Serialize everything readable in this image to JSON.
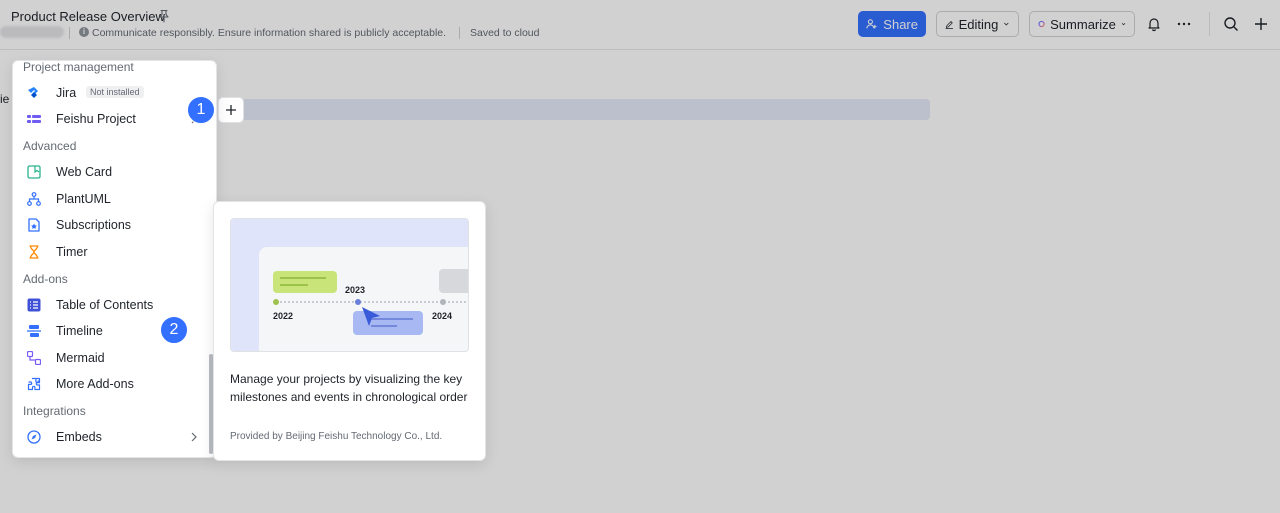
{
  "header": {
    "title": "Product Release Overview",
    "notice": "Communicate responsibly. Ensure information shared is publicly acceptable.",
    "saved_status": "Saved to cloud",
    "share_label": "Share",
    "editing_label": "Editing",
    "summarize_label": "Summarize"
  },
  "document": {
    "cut_text": "ie"
  },
  "menu": {
    "sections": [
      {
        "label": "Project management"
      },
      {
        "label": "Advanced"
      },
      {
        "label": "Add-ons"
      },
      {
        "label": "Integrations"
      }
    ],
    "items": [
      {
        "label": "Jira",
        "badge": "Not installed",
        "icon": "jira-icon"
      },
      {
        "label": "Feishu Project",
        "icon": "feishu-project-icon"
      },
      {
        "label": "Web Card",
        "icon": "web-card-icon"
      },
      {
        "label": "PlantUML",
        "icon": "plantuml-icon"
      },
      {
        "label": "Subscriptions",
        "icon": "subscriptions-icon"
      },
      {
        "label": "Timer",
        "icon": "hourglass-icon"
      },
      {
        "label": "Table of Contents",
        "icon": "table-of-contents-icon"
      },
      {
        "label": "Timeline",
        "icon": "timeline-icon"
      },
      {
        "label": "Mermaid",
        "icon": "mermaid-icon"
      },
      {
        "label": "More Add-ons",
        "icon": "puzzle-icon"
      },
      {
        "label": "Embeds",
        "icon": "compass-icon"
      }
    ]
  },
  "callouts": {
    "first": "1",
    "second": "2"
  },
  "preview": {
    "year_2022": "2022",
    "year_2023": "2023",
    "year_2024": "2024",
    "description": "Manage your projects by visualizing the key milestones and events in chronological order",
    "provider": "Provided by Beijing Feishu Technology Co., Ltd."
  },
  "colors": {
    "accent": "#3370ff",
    "highlight_bar": "#e6ebfa"
  }
}
